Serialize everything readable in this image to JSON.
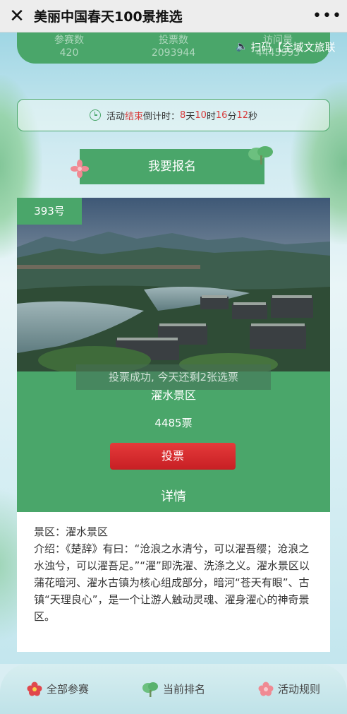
{
  "window": {
    "title": "美丽中国春天100景推选",
    "close_icon": "close-icon",
    "more_icon": "more-icon"
  },
  "stats": [
    {
      "label": "参赛数",
      "value": "420"
    },
    {
      "label": "投票数",
      "value": "2093944"
    },
    {
      "label": "访问量",
      "value": "4445993"
    }
  ],
  "marquee": {
    "text": "扫码【全域文旅联"
  },
  "countdown": {
    "prefix": "活动",
    "end_word": "结束",
    "label": "倒计时：",
    "days": "8",
    "days_unit": "天",
    "hours": "10",
    "hours_unit": "时",
    "minutes": "16",
    "minutes_unit": "分",
    "seconds": "12",
    "seconds_unit": "秒"
  },
  "signup": {
    "label": "我要报名"
  },
  "entry": {
    "number": "393号",
    "toast": "投票成功, 今天还剩2张选票",
    "name": "濯水景区",
    "votes": "4485票",
    "vote_button": "投票"
  },
  "details": {
    "heading": "详情",
    "scenic_label": "景区：濯水景区",
    "intro": "介绍：《楚辞》有曰：“沧浪之水清兮，可以濯吾缨；沧浪之水浊兮，可以濯吾足。”“濯”即洗濯、洗涤之义。濯水景区以蒲花暗河、濯水古镇为核心组成部分，暗河“苍天有眼”、古镇“天理良心”，是一个让游人触动灵魂、濯身濯心的神奇景区。"
  },
  "nav": [
    {
      "label": "全部参赛",
      "icon": "flower-icon"
    },
    {
      "label": "当前排名",
      "icon": "tree-icon"
    },
    {
      "label": "活动规则",
      "icon": "flower-icon"
    }
  ],
  "colors": {
    "accent": "#4aa66a",
    "vote": "#d62a2e",
    "countdown_number": "#d83a3a"
  }
}
